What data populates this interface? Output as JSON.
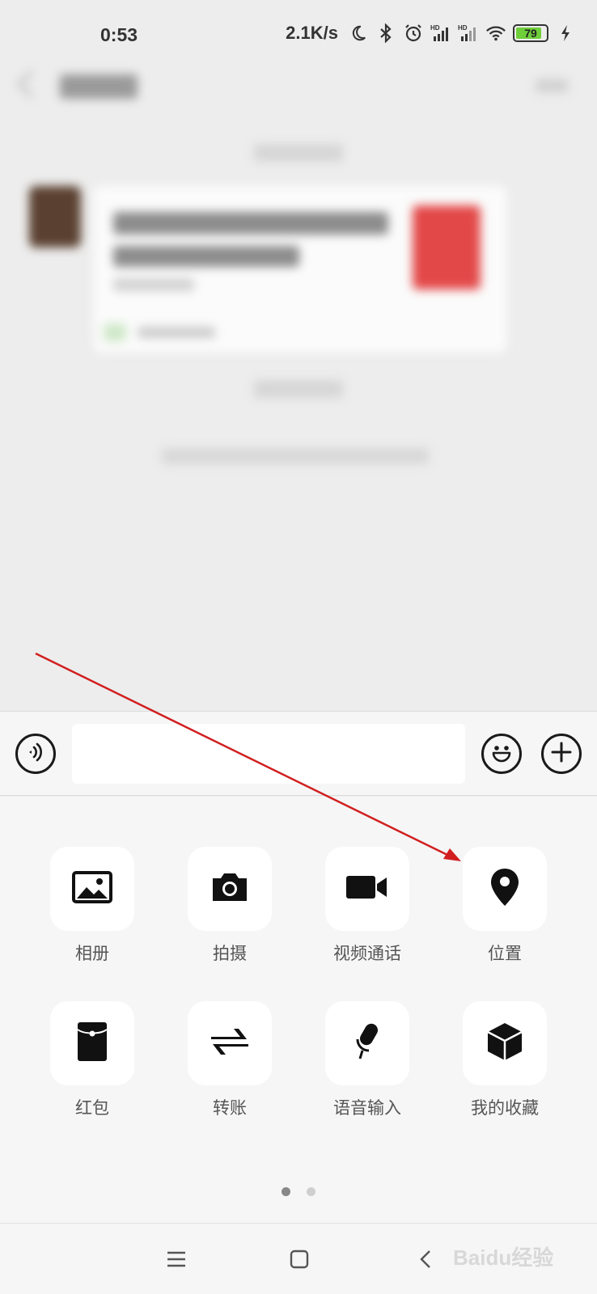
{
  "status_bar": {
    "time": "0:53",
    "net_speed": "2.1K/s",
    "battery": "79",
    "icons": [
      "moon-icon",
      "bluetooth-icon",
      "alarm-icon",
      "hd-signal-icon",
      "hd-signal-icon",
      "wifi-icon",
      "battery-icon",
      "charging-icon"
    ],
    "battery_color": "#6fcf3a"
  },
  "input_bar": {
    "voice_icon": "voice-icon",
    "text_value": "",
    "emoji_icon": "emoji-icon",
    "plus_icon": "plus-icon"
  },
  "panel": {
    "items": [
      {
        "label": "相册",
        "icon": "album-icon"
      },
      {
        "label": "拍摄",
        "icon": "camera-icon"
      },
      {
        "label": "视频通话",
        "icon": "video-call-icon"
      },
      {
        "label": "位置",
        "icon": "location-icon"
      },
      {
        "label": "红包",
        "icon": "red-packet-icon"
      },
      {
        "label": "转账",
        "icon": "transfer-icon"
      },
      {
        "label": "语音输入",
        "icon": "voice-input-icon"
      },
      {
        "label": "我的收藏",
        "icon": "favorites-icon"
      }
    ],
    "page_count": 2,
    "current_page": 1
  },
  "nav_bar": {
    "watermark": "Baidu经验"
  },
  "annotation": {
    "arrow_color": "#d11f1f"
  }
}
